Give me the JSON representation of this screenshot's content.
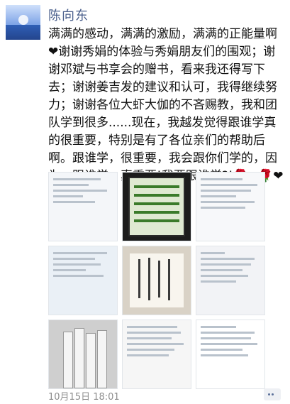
{
  "author": {
    "name": "陈向东"
  },
  "post": {
    "text": "满满的感动，满满的激励，满满的正能量啊❤谢谢秀娟的体验与秀娟朋友们的围观；谢谢邓斌与书享会的赠书，看来我还得写下去；谢谢姜吉发的建议和认可，我得继续努力；谢谢各位大虾大伽的不吝赐教，我和团队学到很多......现在，我越发觉得跟谁学真的很重要，特别是有了各位亲们的帮助后啊。跟谁学，很重要，我会跟你们学的，因为，跟谁学，真重要!我要跟谁学?!🌹❤🌹❤🌹🎈"
  },
  "images": [
    "chat-screenshot-1",
    "phone-order-notice",
    "article-screenshot",
    "chat-screenshot-2",
    "handwritten-note",
    "long-text-screenshot",
    "book-stack-photo",
    "document-page",
    "article-text-page"
  ],
  "footer": {
    "timestamp": "10月15日 18:01"
  }
}
